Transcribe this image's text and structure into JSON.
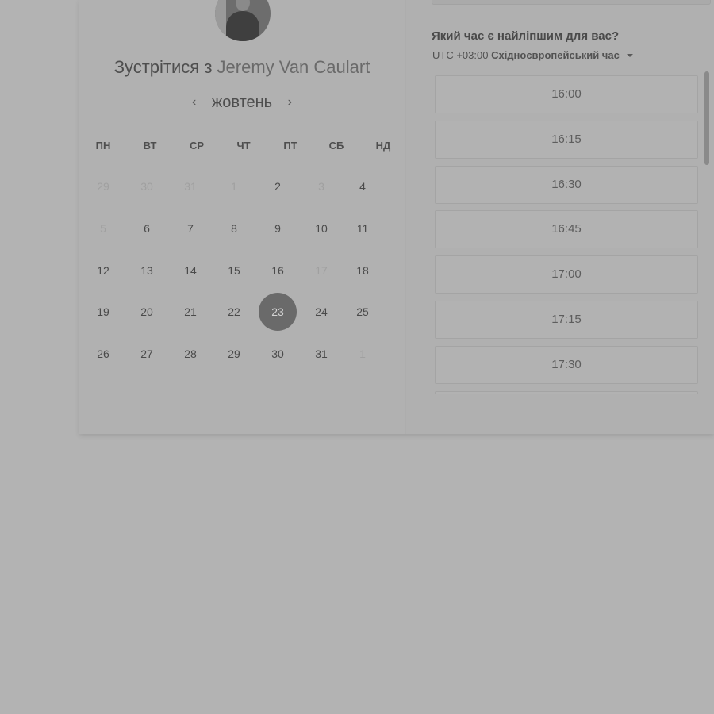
{
  "booking": {
    "title_prefix": "Зустрітися з",
    "host_name": "Jeremy Van Caulart"
  },
  "calendar": {
    "month": "жовтень",
    "prev_icon": "chevron-left-icon",
    "next_icon": "chevron-right-icon",
    "prev_glyph": "‹",
    "next_glyph": "›",
    "weekdays": [
      "ПН",
      "ВТ",
      "СР",
      "ЧТ",
      "ПТ",
      "СБ",
      "НД"
    ],
    "weeks": [
      [
        {
          "label": "29",
          "state": "muted"
        },
        {
          "label": "30",
          "state": "muted"
        },
        {
          "label": "31",
          "state": "muted"
        },
        {
          "label": "1",
          "state": "muted"
        },
        {
          "label": "2",
          "state": "available"
        },
        {
          "label": "3",
          "state": "muted"
        },
        {
          "label": "4",
          "state": "available"
        }
      ],
      [
        {
          "label": "5",
          "state": "muted"
        },
        {
          "label": "6",
          "state": "available"
        },
        {
          "label": "7",
          "state": "available"
        },
        {
          "label": "8",
          "state": "available"
        },
        {
          "label": "9",
          "state": "available"
        },
        {
          "label": "10",
          "state": "available"
        },
        {
          "label": "11",
          "state": "available"
        }
      ],
      [
        {
          "label": "12",
          "state": "available"
        },
        {
          "label": "13",
          "state": "available"
        },
        {
          "label": "14",
          "state": "available"
        },
        {
          "label": "15",
          "state": "available"
        },
        {
          "label": "16",
          "state": "available"
        },
        {
          "label": "17",
          "state": "muted"
        },
        {
          "label": "18",
          "state": "available"
        }
      ],
      [
        {
          "label": "19",
          "state": "available"
        },
        {
          "label": "20",
          "state": "available"
        },
        {
          "label": "21",
          "state": "available"
        },
        {
          "label": "22",
          "state": "available"
        },
        {
          "label": "23",
          "state": "selected"
        },
        {
          "label": "24",
          "state": "available"
        },
        {
          "label": "25",
          "state": "available"
        }
      ],
      [
        {
          "label": "26",
          "state": "available"
        },
        {
          "label": "27",
          "state": "available"
        },
        {
          "label": "28",
          "state": "available"
        },
        {
          "label": "29",
          "state": "available"
        },
        {
          "label": "30",
          "state": "available"
        },
        {
          "label": "31",
          "state": "available"
        },
        {
          "label": "1",
          "state": "muted"
        }
      ]
    ]
  },
  "times": {
    "question": "Який час є найліпшим для вас?",
    "timezone_offset": "UTC +03:00",
    "timezone_name": "Східноєвропейський час",
    "slots": [
      "16:00",
      "16:15",
      "16:30",
      "16:45",
      "17:00",
      "17:15",
      "17:30",
      ""
    ]
  },
  "colors": {
    "overlay_background": "#b3b3b3",
    "selected_day": "#6a6a6a"
  }
}
